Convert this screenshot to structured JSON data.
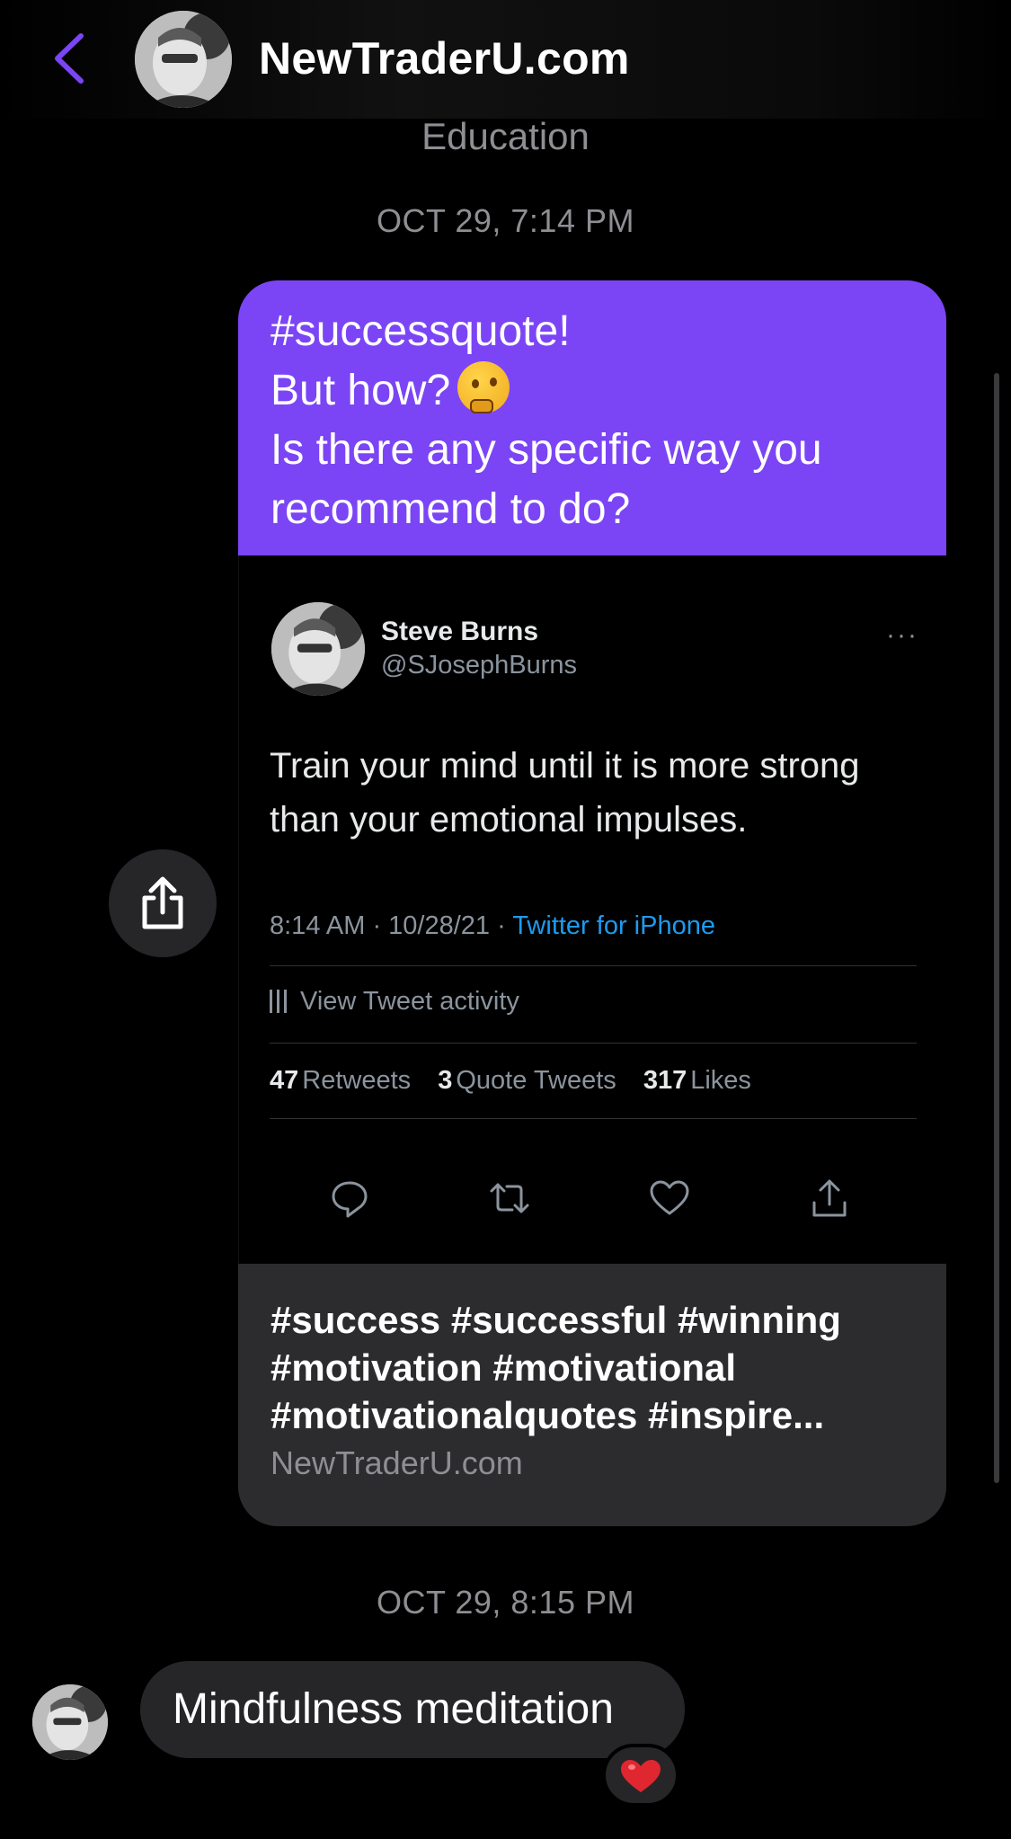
{
  "header": {
    "title": "NewTraderU.com",
    "subtitle": "Education",
    "back_icon": "chevron-left-icon"
  },
  "colors": {
    "accent": "#7b45f5",
    "bubble_received": "#262628",
    "twitter_link": "#1d9bf0",
    "heart": "#e0262f"
  },
  "thread": {
    "timestamp_1": "OCT 29, 7:14 PM",
    "timestamp_2": "OCT 29, 8:15 PM",
    "sent_message": {
      "line1": "#successquote!",
      "line2": "But how?",
      "line2_emoji": "thinking-face",
      "line3": "Is there any specific way you",
      "line4": "recommend to do?"
    },
    "tweet": {
      "name": "Steve Burns",
      "handle": "@SJosephBurns",
      "more": "···",
      "text": "Train your mind until it is more strong than your emotional impulses.",
      "time_date": "8:14 AM · 10/28/21 · ",
      "source": "Twitter for iPhone",
      "activity_label": "View Tweet activity",
      "retweets_count": "47",
      "retweets_label": "Retweets",
      "quote_count": "3",
      "quote_label": "Quote Tweets",
      "likes_count": "317",
      "likes_label": "Likes"
    },
    "link_preview": {
      "title_line1": "#success #successful #winning",
      "title_line2": "#motivation #motivational",
      "title_line3": "#motivationalquotes #inspire...",
      "domain": "NewTraderU.com"
    },
    "received_message": {
      "text": "Mindfulness meditation",
      "reaction": "heart-icon"
    }
  }
}
